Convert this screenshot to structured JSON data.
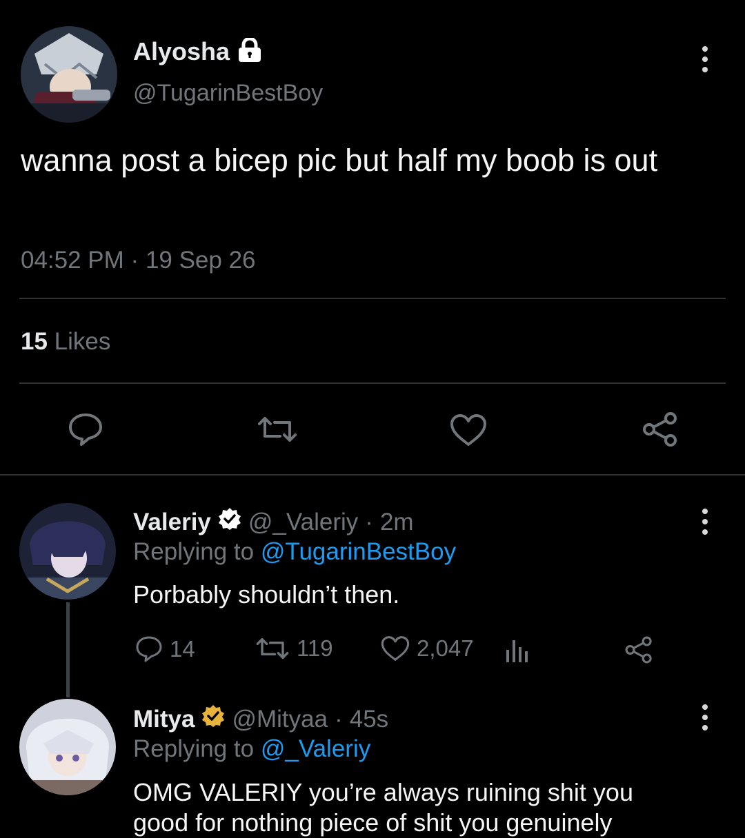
{
  "tweet": {
    "name": "Alyosha",
    "lock_icon": "lock-icon",
    "handle": "@TugarinBestBoy",
    "text": "wanna post a bicep pic but half my boob is out",
    "time": "04:52 PM",
    "date": "19 Sep 26",
    "likes_count": "15",
    "likes_label": "Likes",
    "actions": [
      "reply-icon",
      "retweet-icon",
      "like-icon",
      "share-icon"
    ]
  },
  "replies": [
    {
      "name": "Valeriy",
      "badge_color": "#ffffff",
      "handle": "@_Valeriy",
      "time": "2m",
      "replying_to_label": "Replying to",
      "replying_to": "@TugarinBestBoy",
      "text": "Porbably shouldn’t then.",
      "reply_count": "14",
      "retweet_count": "119",
      "like_count": "2,047"
    },
    {
      "name": "Mitya",
      "badge_color": "#e8b33b",
      "handle": "@Mityaa",
      "time": "45s",
      "replying_to_label": "Replying to",
      "replying_to": "@_Valeriy",
      "text_line1": "OMG VALERIY you’re always ruining shit you",
      "text_line2": "good for nothing piece of shit you genuinely"
    }
  ],
  "colors": {
    "background": "#000000",
    "link": "#1d9bf0",
    "muted": "#71767b",
    "divider": "#2f3336"
  }
}
